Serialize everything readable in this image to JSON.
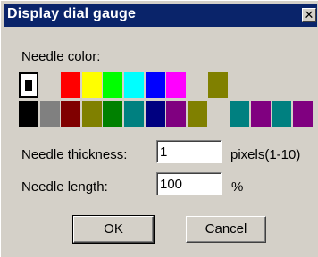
{
  "dialog": {
    "title": "Display dial gauge",
    "close_label": "✕"
  },
  "needle_color": {
    "label": "Needle color:",
    "palette_rows": [
      [
        "#ffffff",
        "#d4d0c8",
        "#ff0000",
        "#ffff00",
        "#00ff00",
        "#00ffff",
        "#0000ff",
        "#ff00ff",
        "#d4d0c8",
        "#808000",
        "#d4d0c8",
        "#d4d0c8",
        "#d4d0c8",
        "#d4d0c8"
      ],
      [
        "#000000",
        "#808080",
        "#800000",
        "#808000",
        "#008000",
        "#008080",
        "#000080",
        "#800080",
        "#808000",
        "#d4d0c8",
        "#008080",
        "#800080",
        "#008080",
        "#800080"
      ]
    ],
    "selected": "#000000"
  },
  "thickness": {
    "label": "Needle thickness:",
    "value": "1",
    "unit": "pixels(1-10)"
  },
  "length": {
    "label": "Needle length:",
    "value": "100",
    "unit": "%"
  },
  "buttons": {
    "ok": "OK",
    "cancel": "Cancel"
  }
}
